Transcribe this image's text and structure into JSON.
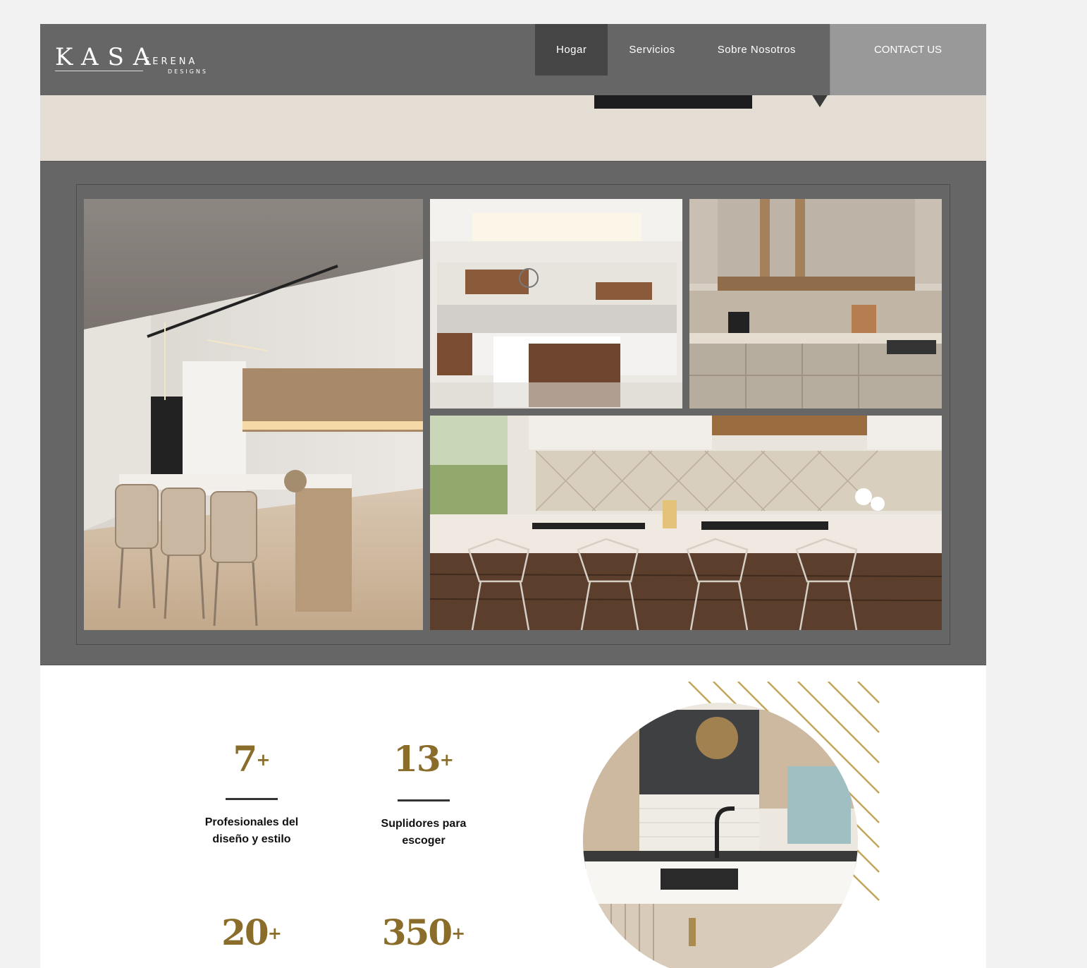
{
  "logo": {
    "main": "KASA",
    "sub": "SERENA",
    "sub2": "DESIGNS"
  },
  "nav": {
    "items": [
      {
        "label": "Hogar",
        "active": true
      },
      {
        "label": "Servicios",
        "active": false
      },
      {
        "label": "Sobre Nosotros",
        "active": false
      }
    ],
    "contact_label": "CONTACT US"
  },
  "stats": [
    {
      "value": "7",
      "suffix": "+",
      "label_line1": "Profesionales del",
      "label_line2": "diseño y estilo"
    },
    {
      "value": "13",
      "suffix": "+",
      "label_line1": "Suplidores para",
      "label_line2": "escoger"
    },
    {
      "value": "20",
      "suffix": "+",
      "label_line1": "",
      "label_line2": ""
    },
    {
      "value": "350",
      "suffix": "+",
      "label_line1": "",
      "label_line2": ""
    }
  ],
  "colors": {
    "header": "#666666",
    "nav_active": "#454545",
    "contact_bg": "#999999",
    "gallery_bg": "#666666",
    "accent_gold": "#8a6d2a"
  }
}
